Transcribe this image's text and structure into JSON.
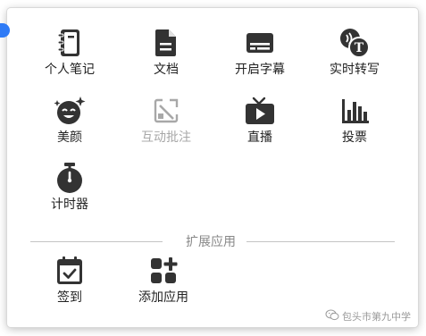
{
  "tools": [
    {
      "label": "个人笔记",
      "icon": "notebook-icon"
    },
    {
      "label": "文档",
      "icon": "document-icon"
    },
    {
      "label": "开启字幕",
      "icon": "subtitles-icon"
    },
    {
      "label": "实时转写",
      "icon": "transcribe-icon"
    },
    {
      "label": "美颜",
      "icon": "beauty-face-icon"
    },
    {
      "label": "互动批注",
      "icon": "annotate-icon",
      "disabled": true
    },
    {
      "label": "直播",
      "icon": "live-tv-icon"
    },
    {
      "label": "投票",
      "icon": "vote-chart-icon"
    },
    {
      "label": "计时器",
      "icon": "timer-icon"
    }
  ],
  "extensions_section": {
    "title": "扩展应用",
    "items": [
      {
        "label": "签到",
        "icon": "check-in-calendar-icon"
      },
      {
        "label": "添加应用",
        "icon": "add-app-icon"
      }
    ]
  },
  "watermark": {
    "text": "包头市第九中学",
    "icon": "wechat-icon"
  },
  "colors": {
    "icon": "#333333",
    "disabled": "#a8a8a8",
    "accent": "#2f7bf6",
    "divider": "#c4c4c4"
  }
}
